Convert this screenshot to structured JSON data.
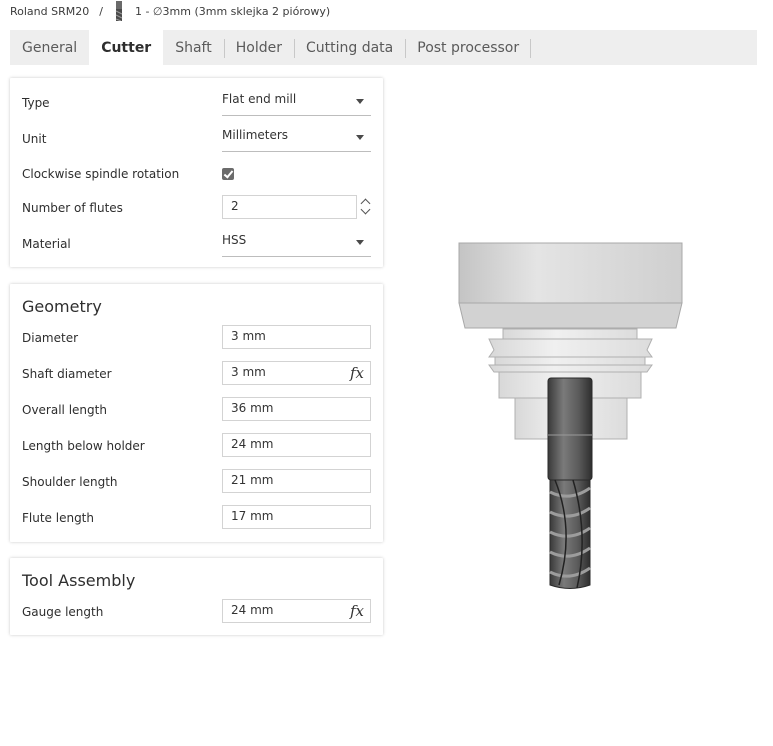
{
  "breadcrumb": {
    "machine": "Roland SRM20",
    "separator": "/",
    "tool": "1 - ∅3mm (3mm sklejka 2 piórowy)"
  },
  "tabs": [
    {
      "label": "General",
      "active": false
    },
    {
      "label": "Cutter",
      "active": true
    },
    {
      "label": "Shaft",
      "active": false
    },
    {
      "label": "Holder",
      "active": false
    },
    {
      "label": "Cutting data",
      "active": false
    },
    {
      "label": "Post processor",
      "active": false
    }
  ],
  "cutter": {
    "type": {
      "label": "Type",
      "value": "Flat end mill"
    },
    "unit": {
      "label": "Unit",
      "value": "Millimeters"
    },
    "clockwise": {
      "label": "Clockwise spindle rotation",
      "checked": true
    },
    "flutes": {
      "label": "Number of flutes",
      "value": "2"
    },
    "material": {
      "label": "Material",
      "value": "HSS"
    }
  },
  "geometry": {
    "title": "Geometry",
    "diameter": {
      "label": "Diameter",
      "value": "3 mm"
    },
    "shaft_diameter": {
      "label": "Shaft diameter",
      "value": "3 mm",
      "fx": "fx"
    },
    "overall_length": {
      "label": "Overall length",
      "value": "36 mm"
    },
    "length_below_holder": {
      "label": "Length below holder",
      "value": "24 mm"
    },
    "shoulder_length": {
      "label": "Shoulder length",
      "value": "21 mm"
    },
    "flute_length": {
      "label": "Flute length",
      "value": "17 mm"
    }
  },
  "assembly": {
    "title": "Tool Assembly",
    "gauge_length": {
      "label": "Gauge length",
      "value": "24 mm",
      "fx": "fx"
    }
  },
  "colors": {
    "tab_bar": "#eeeeee",
    "holder": "#d4d4d4",
    "tool": "#5a5a5a"
  }
}
